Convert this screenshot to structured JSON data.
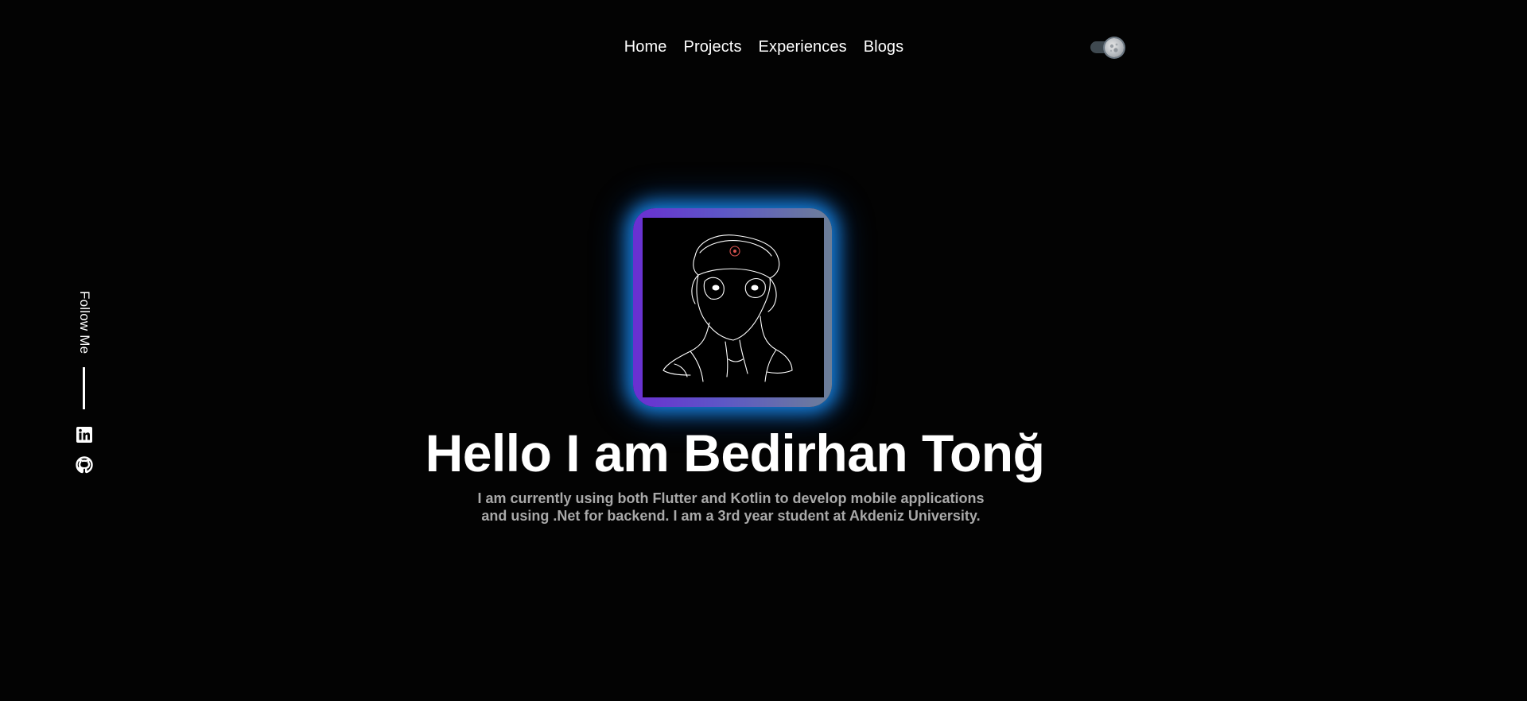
{
  "nav": {
    "items": [
      {
        "label": "Home"
      },
      {
        "label": "Projects"
      },
      {
        "label": "Experiences"
      },
      {
        "label": "Blogs"
      }
    ]
  },
  "theme_toggle": {
    "state": "dark",
    "icon": "moon-icon"
  },
  "social": {
    "follow_label": "Follow Me",
    "links": [
      {
        "icon": "linkedin-icon"
      },
      {
        "icon": "github-icon"
      }
    ]
  },
  "hero": {
    "avatar_icon": "avatar-sketch",
    "headline": "Hello I am Bedirhan Tonğ",
    "description_lines": [
      "I am currently using both Flutter and Kotlin to develop mobile applications",
      "and using .Net for backend. I am a 3rd year student at Akdeniz University."
    ]
  },
  "colors": {
    "background": "#030303",
    "text": "#ffffff",
    "muted_text": "#a9a9a9",
    "glow": "#198cf0",
    "frame_gradient_start": "#6a2fd2",
    "frame_gradient_end": "#6d7f98"
  }
}
